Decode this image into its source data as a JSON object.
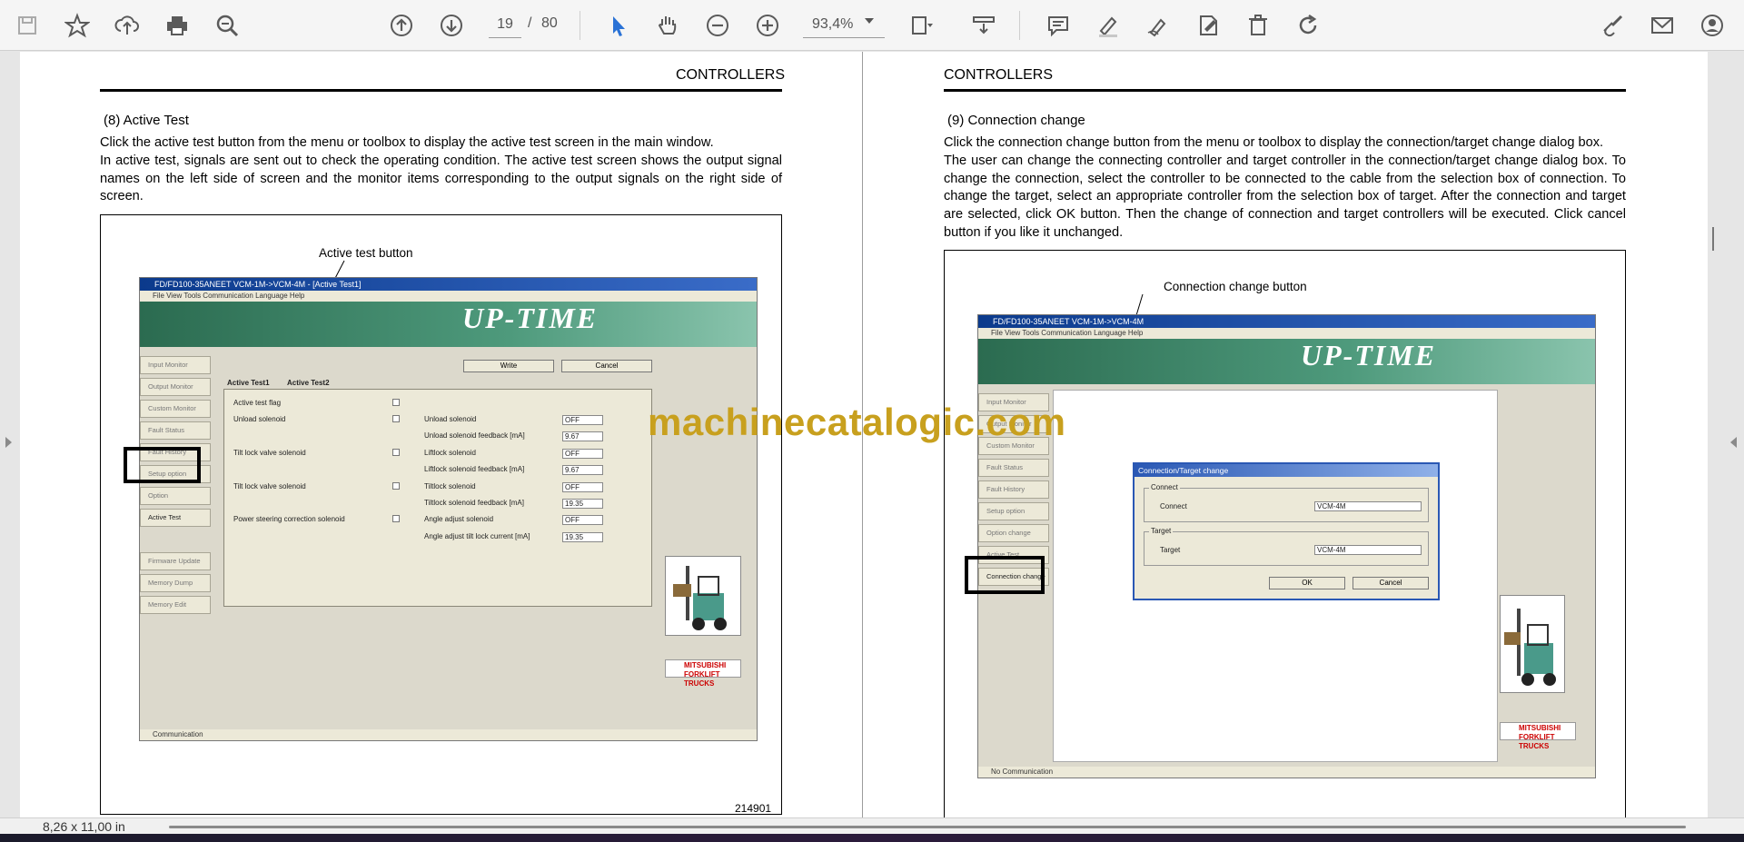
{
  "toolbar": {
    "icons": [
      "save-icon",
      "bookmark-star-icon",
      "upload-cloud-icon",
      "print-icon",
      "zoom-out-magnifier-icon",
      "previous-page-icon",
      "next-page-icon",
      "select-arrow-icon",
      "hand-tool-icon",
      "zoom-out-icon",
      "zoom-in-icon",
      "fit-page-icon",
      "scroll-mode-icon",
      "comment-icon",
      "highlight-pen-icon",
      "draw-icon",
      "sign-icon",
      "delete-icon",
      "rotate-icon",
      "edit-link-icon",
      "email-icon",
      "add-user-icon"
    ],
    "page_current": "19",
    "page_separator": "/",
    "page_total": "80",
    "zoom": "93,4%"
  },
  "left_page": {
    "header": "CONTROLLERS",
    "section_title": "(8)  Active Test",
    "paragraph_1": "Click the active test button from the menu or toolbox to display the active test screen in the main window.",
    "paragraph_2": "In active test, signals are sent out to check the operating condition. The active test screen shows the output signal names on the left side of screen and the monitor items corresponding to the output signals on the right side of screen.",
    "callout": "Active test button",
    "figure_number": "214901",
    "app": {
      "title": "FD/FD100-35ANEET VCM-1M->VCM-4M - [Active Test1]",
      "menu": "File   View   Tools   Communication   Language   Help",
      "banner": "UP-TIME",
      "sidebar": [
        "Input Monitor",
        "Output Monitor",
        "Custom Monitor",
        "Fault Status",
        "Fault History",
        "Setup option",
        "Option",
        "Active Test",
        "Firmware Update",
        "Memory Dump",
        "Memory Edit"
      ],
      "write_label": "Write",
      "cancel_label": "Cancel",
      "tab_1": "Active Test1",
      "tab_2": "Active Test2",
      "left_items": [
        "Active test flag",
        "Unload solenoid",
        "Tilt lock valve solenoid",
        "Tilt lock valve solenoid",
        "Power steering correction solenoid"
      ],
      "right_items": [
        {
          "label": "Unload solenoid",
          "value": "OFF"
        },
        {
          "label": "Unload solenoid feedback [mA]",
          "value": "9.67"
        },
        {
          "label": "Liftlock solenoid",
          "value": "OFF"
        },
        {
          "label": "Liftlock solenoid feedback [mA]",
          "value": "9.67"
        },
        {
          "label": "Tiltlock solenoid",
          "value": "OFF"
        },
        {
          "label": "Tiltlock solenoid feedback [mA]",
          "value": "19.35"
        },
        {
          "label": "Angle adjust solenoid",
          "value": "OFF"
        },
        {
          "label": "Angle adjust tilt lock current [mA]",
          "value": "19.35"
        }
      ],
      "status": "Communication",
      "logo": "MITSUBISHI FORKLIFT TRUCKS"
    }
  },
  "right_page": {
    "header": "CONTROLLERS",
    "section_title": "(9)  Connection change",
    "paragraph_1": "Click the connection change button from the menu or toolbox to display the connection/target change dialog box.",
    "paragraph_2": "The user can change the connecting controller and target controller in the connection/target change dialog box. To change the connection, select the controller to be connected to the cable from the selection box of connection. To change the target, select an appropriate controller from the selection box of target. After the connection and target are selected, click OK button. Then the change of connection and target controllers will be executed. Click cancel button if you like it unchanged.",
    "callout": "Connection change button",
    "app": {
      "title": "FD/FD100-35ANEET VCM-1M->VCM-4M",
      "menu": "File   View   Tools   Communication   Language   Help",
      "banner": "UP-TIME",
      "sidebar": [
        "Input Monitor",
        "Output Monitor",
        "Custom Monitor",
        "Fault Status",
        "Fault History",
        "Setup option",
        "Option change",
        "Active Test",
        "Connection change"
      ],
      "dialog_title": "Connection/Target change",
      "connect_group": "Connect",
      "connect_label": "Connect",
      "connect_value": "VCM-4M",
      "target_group": "Target",
      "target_label": "Target",
      "target_value": "VCM-4M",
      "ok_label": "OK",
      "cancel_label": "Cancel",
      "status": "No Communication",
      "logo": "MITSUBISHI FORKLIFT TRUCKS"
    }
  },
  "watermark": "machinecatalogic.com",
  "status_bar": {
    "page_size": "8,26 x 11,00 in"
  }
}
